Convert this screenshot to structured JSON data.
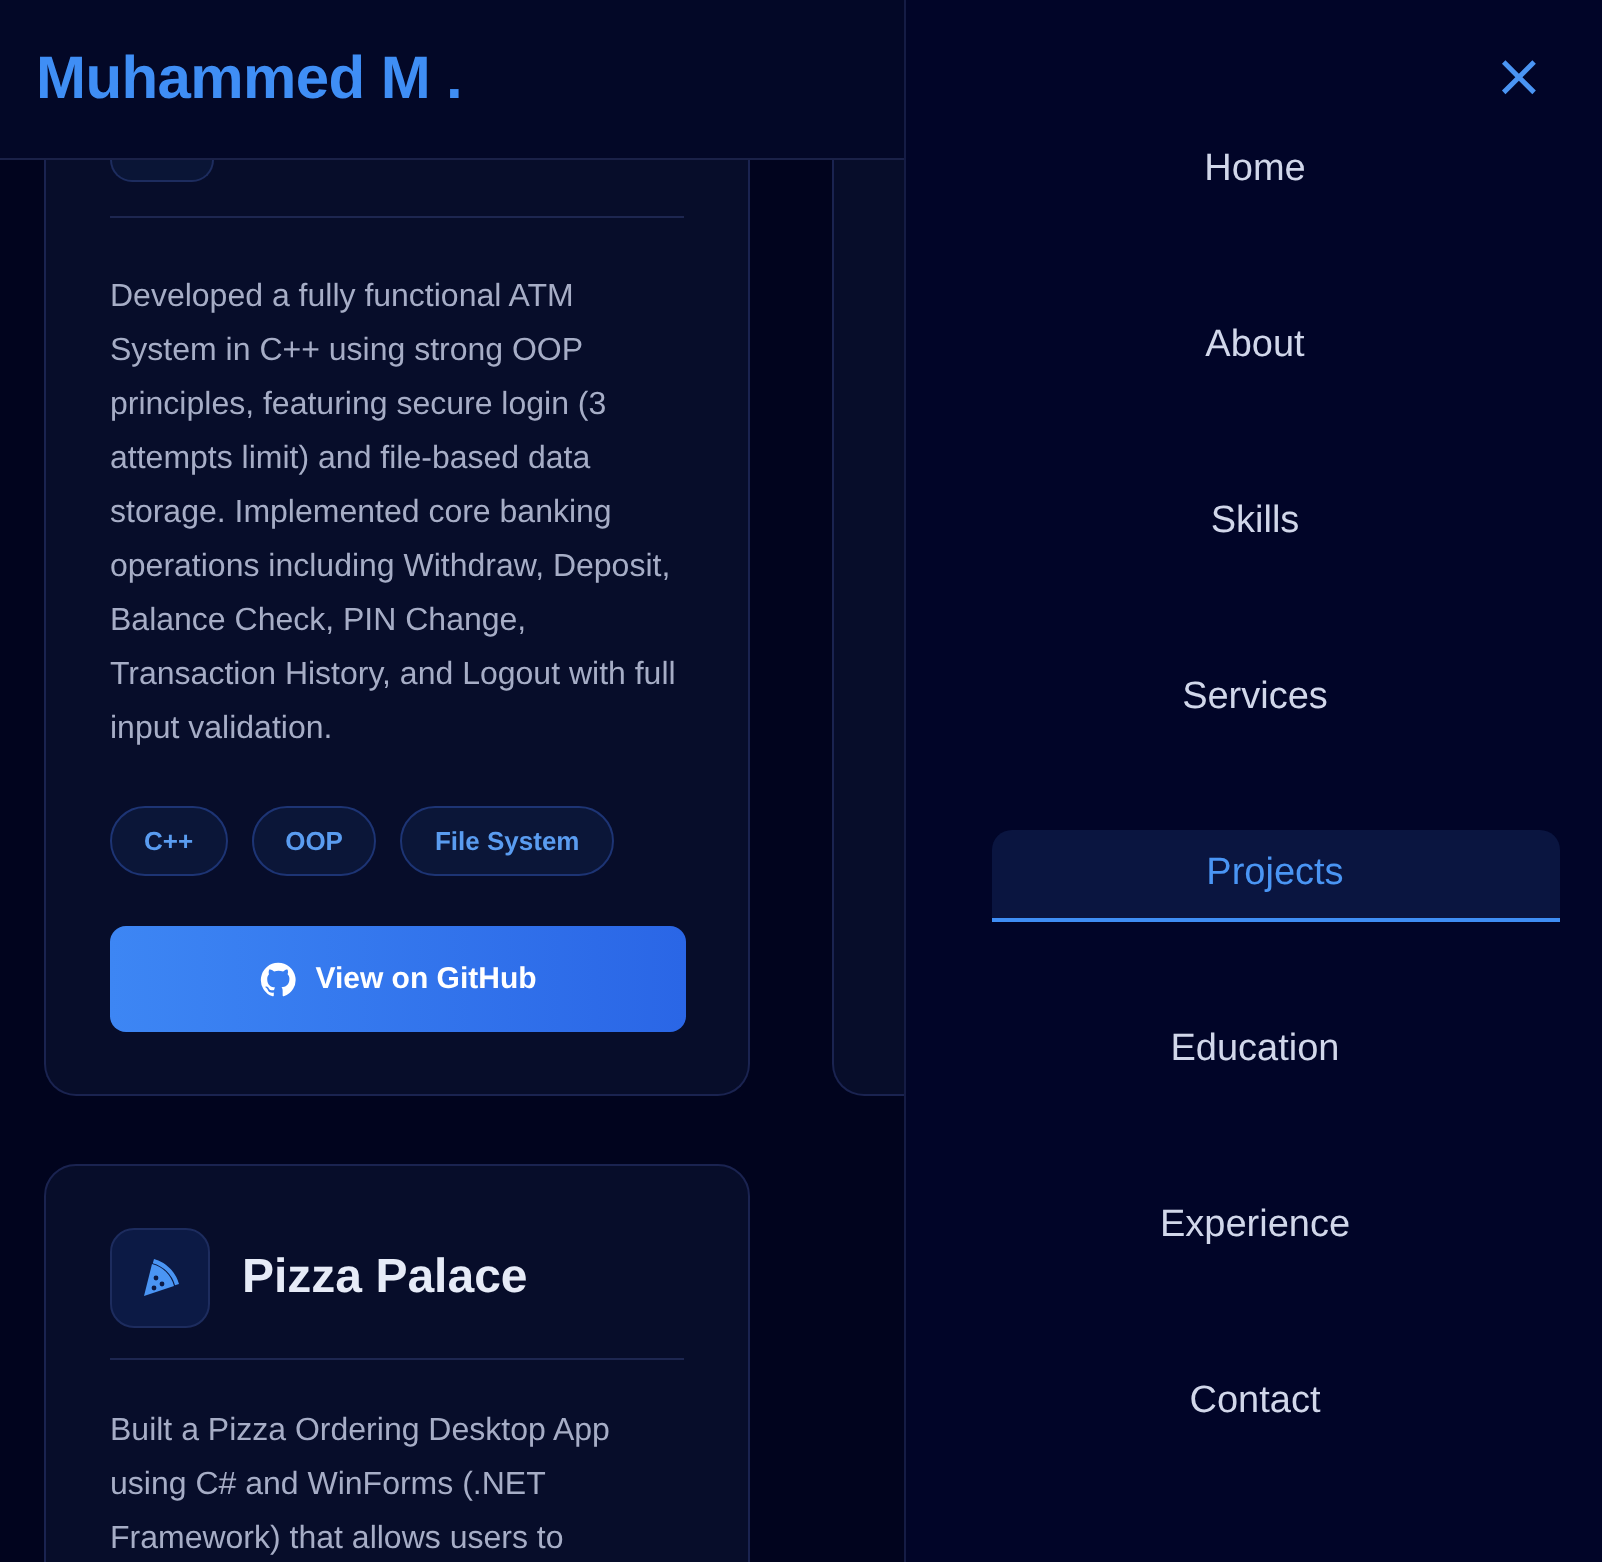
{
  "header": {
    "title": "Muhammed M ."
  },
  "projects": [
    {
      "description": "Developed a fully functional ATM System in C++ using strong OOP principles, featuring secure login (3 attempts limit) and file-based data storage. Implemented core banking operations including Withdraw, Deposit, Balance Check, PIN Change, Transaction History, and Logout with full input validation.",
      "tags": [
        "C++",
        "OOP",
        "File System"
      ],
      "button": "View on GitHub"
    },
    {
      "title": "Pizza Palace",
      "description": "Built a Pizza Ordering Desktop App using C# and WinForms (.NET Framework) that allows users to"
    }
  ],
  "drawer": {
    "close": "×",
    "items": [
      {
        "label": "Home",
        "selected": false
      },
      {
        "label": "About",
        "selected": false
      },
      {
        "label": "Skills",
        "selected": false
      },
      {
        "label": "Services",
        "selected": false
      },
      {
        "label": "Projects",
        "selected": true
      },
      {
        "label": "Education",
        "selected": false
      },
      {
        "label": "Experience",
        "selected": false
      },
      {
        "label": "Contact",
        "selected": false
      }
    ]
  }
}
